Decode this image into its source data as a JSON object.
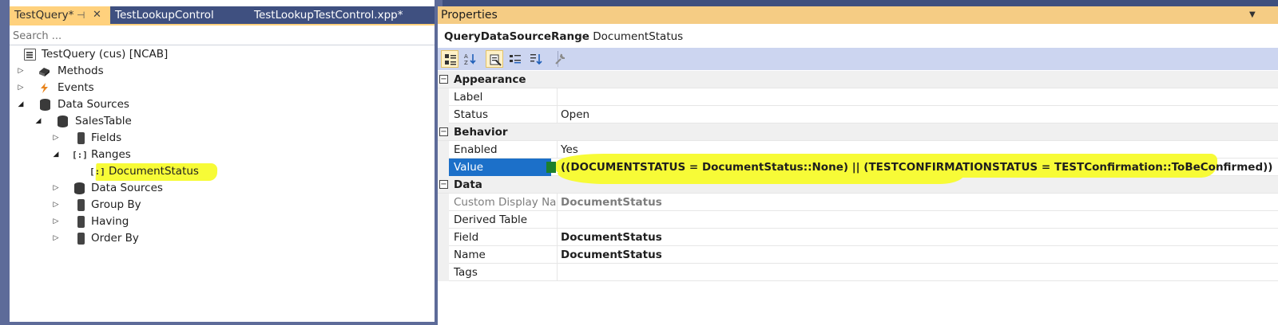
{
  "document_tabs": [
    {
      "label": "TestQuery*",
      "active": true
    },
    {
      "label": "TestLookupControl",
      "active": false
    },
    {
      "label": "TestLookupTestControl.xpp*",
      "active": false
    }
  ],
  "tab_icons": {
    "pin": "⊣",
    "close": "✕"
  },
  "search": {
    "placeholder": "Search ..."
  },
  "tree": {
    "root": "TestQuery (cus) [NCAB]",
    "methods": "Methods",
    "events": "Events",
    "data_sources": "Data Sources",
    "sales_table": "SalesTable",
    "fields": "Fields",
    "ranges": "Ranges",
    "document_status": "DocumentStatus",
    "nested_data_sources": "Data Sources",
    "group_by": "Group By",
    "having": "Having",
    "order_by": "Order By"
  },
  "properties": {
    "title": "Properties",
    "object_type": "QueryDataSourceRange",
    "object_name": "DocumentStatus",
    "categories": {
      "appearance": "Appearance",
      "behavior": "Behavior",
      "data": "Data"
    },
    "collapse_glyph": "−",
    "rows": {
      "label": {
        "name": "Label",
        "value": ""
      },
      "status": {
        "name": "Status",
        "value": "Open"
      },
      "enabled": {
        "name": "Enabled",
        "value": "Yes"
      },
      "value": {
        "name": "Value",
        "value": "((DOCUMENTSTATUS = DocumentStatus::None) || (TESTCONFIRMATIONSTATUS = TESTConfirmation::ToBeConfirmed))"
      },
      "custom_display_name": {
        "name": "Custom Display Name",
        "value": "DocumentStatus"
      },
      "derived_table": {
        "name": "Derived Table",
        "value": ""
      },
      "field": {
        "name": "Field",
        "value": "DocumentStatus"
      },
      "name": {
        "name": "Name",
        "value": "DocumentStatus"
      },
      "tags": {
        "name": "Tags",
        "value": ""
      }
    }
  },
  "colors": {
    "highlight": "#f7fb37",
    "selection": "#1c70c9",
    "active_tab": "#ffd17d",
    "frame": "#5d6b99"
  },
  "icons": {
    "toolbar": [
      "categorized-icon",
      "alphabetical-icon",
      "properties-icon",
      "events-icon",
      "sort-icon",
      "wrench-icon"
    ]
  }
}
